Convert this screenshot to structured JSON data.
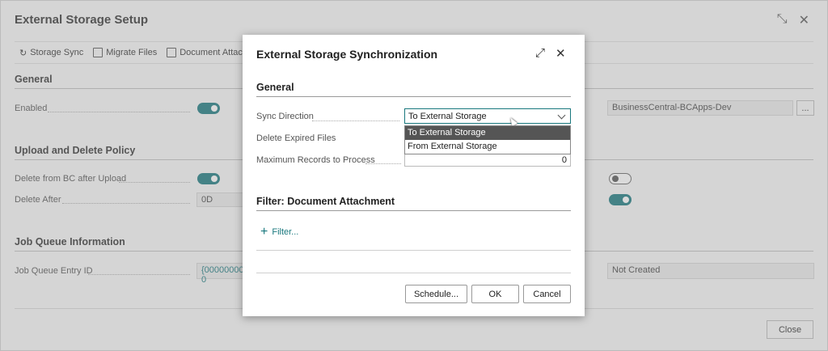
{
  "background": {
    "title": "External Storage Setup",
    "actions": [
      "Storage Sync",
      "Migrate Files",
      "Document Attachme"
    ],
    "sections": {
      "general": "General",
      "upload_delete": "Upload and Delete Policy",
      "job_queue": "Job Queue Information"
    },
    "fields": {
      "enabled": "Enabled",
      "delete_from_bc": "Delete from BC after Upload",
      "delete_after": "Delete After",
      "delete_after_value": "0D",
      "job_queue_entry_id": "Job Queue Entry ID",
      "job_queue_entry_value": "{00000000-0",
      "right_value": "BusinessCentral-BCApps-Dev",
      "right_lookup": "...",
      "not_created": "Not Created"
    },
    "close_label": "Close"
  },
  "dialog": {
    "title": "External Storage Synchronization",
    "general_heading": "General",
    "sync_direction_label": "Sync Direction",
    "sync_direction_value": "To External Storage",
    "delete_expired_label": "Delete Expired Files",
    "max_records_label": "Maximum Records to Process",
    "max_records_value": "0",
    "options": [
      "To External Storage",
      "From External Storage"
    ],
    "filter_heading": "Filter: Document Attachment",
    "filter_link": "Filter...",
    "buttons": {
      "schedule": "Schedule...",
      "ok": "OK",
      "cancel": "Cancel"
    }
  },
  "icons": {
    "expand": "expand-icon",
    "close": "close-icon",
    "collapse": "collapse-icon",
    "plus": "plus-icon"
  },
  "colors": {
    "accent": "#19787e",
    "selected_option": "#555555"
  }
}
